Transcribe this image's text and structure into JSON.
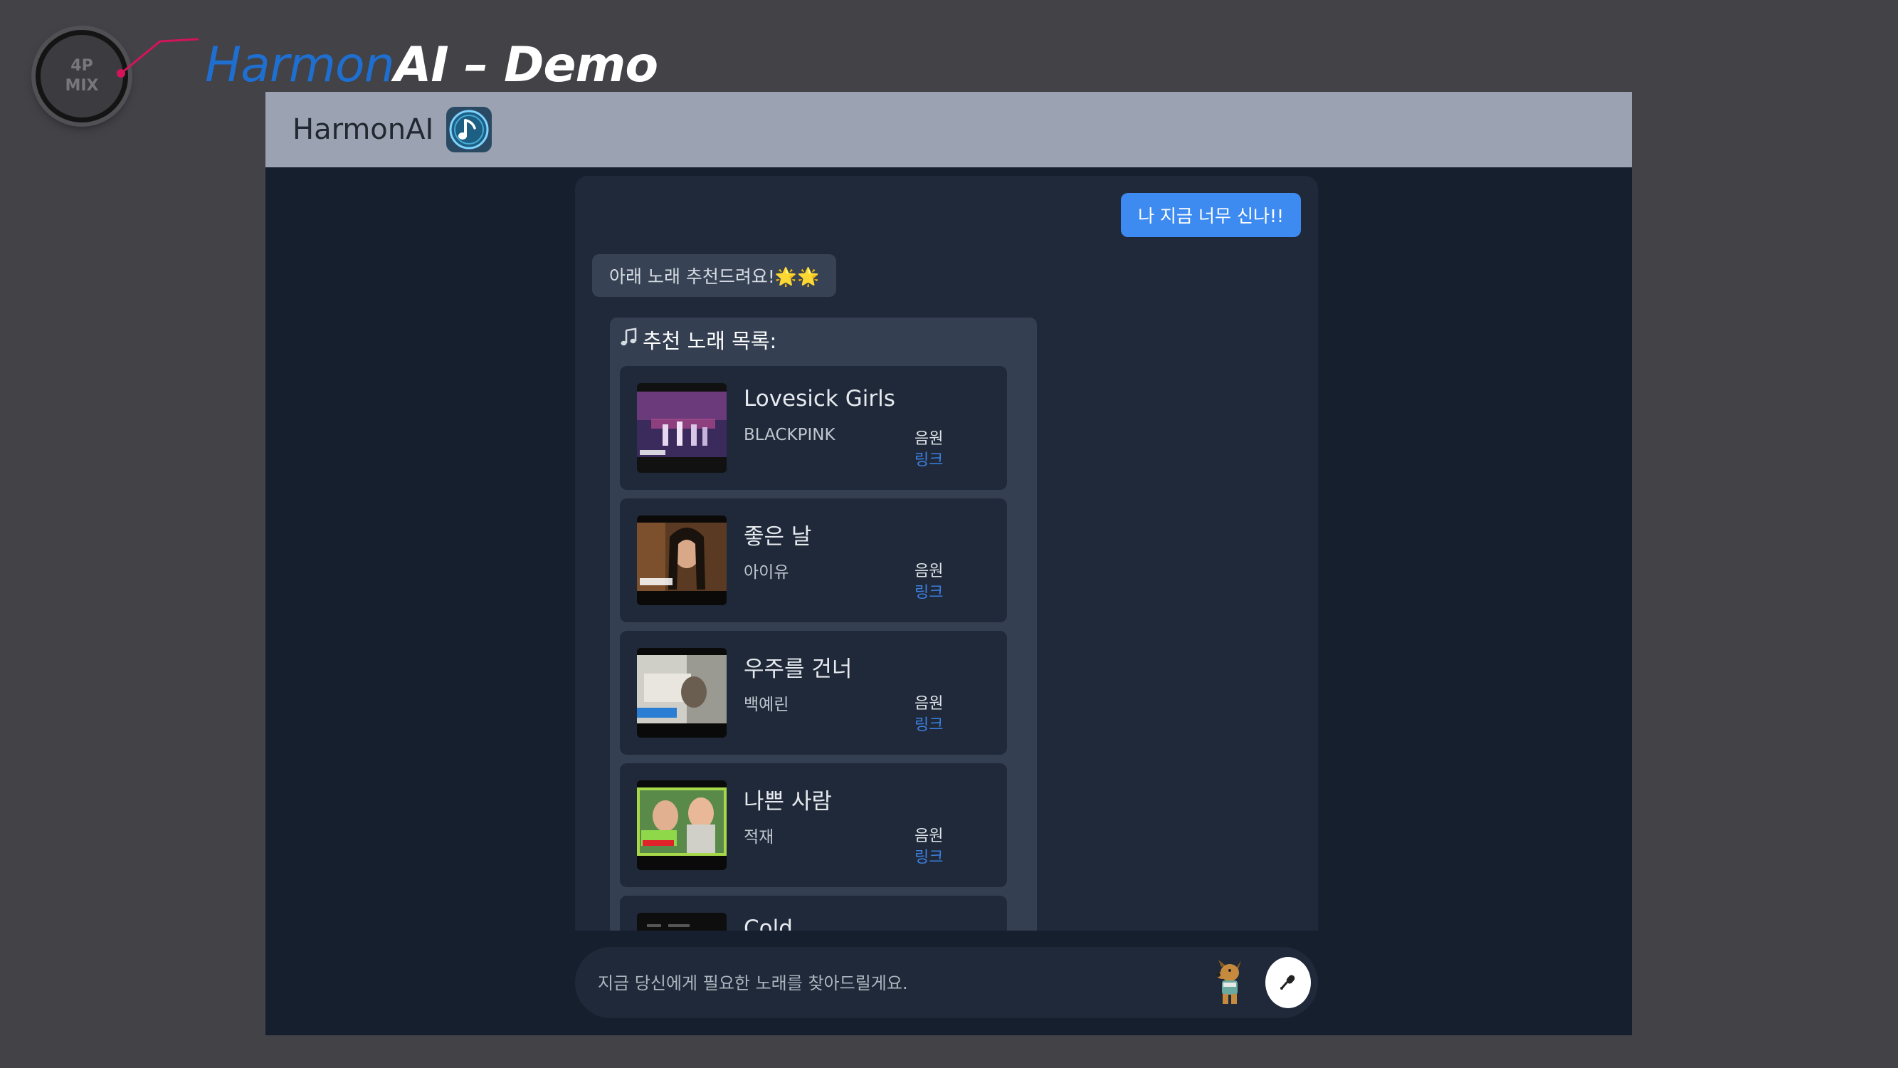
{
  "slide": {
    "logo_line1": "4P",
    "logo_line2": "MIX",
    "title_accent": "Harmon",
    "title_rest": "AI – Demo"
  },
  "app": {
    "name": "HarmonAI",
    "icon": "music-note-icon"
  },
  "chat": {
    "user_message": "나 지금 너무 신나!!",
    "bot_message": "아래 노래 추천드려요!🌟🌟",
    "recommend_header": "추천 노래 목록:",
    "songs": [
      {
        "title": "Lovesick Girls",
        "artist": "BLACKPINK",
        "audio_label": "음원",
        "link_label": "링크"
      },
      {
        "title": "좋은 날",
        "artist": "아이유",
        "audio_label": "음원",
        "link_label": "링크"
      },
      {
        "title": "우주를 건너",
        "artist": "백예린",
        "audio_label": "음원",
        "link_label": "링크"
      },
      {
        "title": "나쁜 사람",
        "artist": "적재",
        "audio_label": "음원",
        "link_label": "링크"
      },
      {
        "title": "Cold",
        "artist": "",
        "audio_label": "",
        "link_label": ""
      }
    ]
  },
  "input": {
    "placeholder": "지금 당신에게 필요한 노래를 찾아드릴게요.",
    "value": "",
    "mic_icon": "microphone-icon"
  },
  "colors": {
    "accent_blue": "#3d8bf0",
    "title_blue": "#1e6fd0",
    "link_blue": "#3d7fe0",
    "header_bg": "#9ba3b2",
    "app_bg": "#161f2e"
  }
}
